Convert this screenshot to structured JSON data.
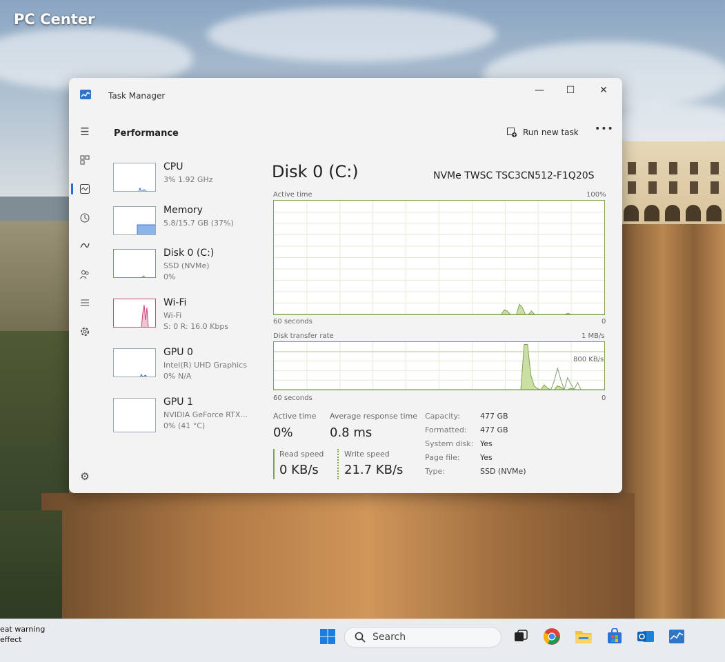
{
  "watermark": {
    "brand": "PC Center"
  },
  "notification": {
    "line1": "eat warning",
    "line2": "effect"
  },
  "window": {
    "title": "Task Manager",
    "controls": {
      "minimize": "—",
      "maximize": "☐",
      "close": "✕"
    }
  },
  "nav": {
    "icons": [
      "hamburger-icon",
      "processes-icon",
      "performance-icon",
      "app-history-icon",
      "startup-apps-icon",
      "users-icon",
      "details-icon",
      "services-icon",
      "settings-icon"
    ],
    "active": "performance-icon"
  },
  "header": {
    "page_title": "Performance",
    "run_new_task": "Run new task",
    "more": "•••"
  },
  "devices": [
    {
      "name": "CPU",
      "sub1": "3% 1.92 GHz",
      "sub2": ""
    },
    {
      "name": "Memory",
      "sub1": "5.8/15.7 GB (37%)",
      "sub2": ""
    },
    {
      "name": "Disk 0 (C:)",
      "sub1": "SSD (NVMe)",
      "sub2": "0%"
    },
    {
      "name": "Wi-Fi",
      "sub1": "Wi-Fi",
      "sub2": "S: 0 R: 16.0 Kbps"
    },
    {
      "name": "GPU 0",
      "sub1": "Intel(R) UHD Graphics",
      "sub2": "0% N/A"
    },
    {
      "name": "GPU 1",
      "sub1": "NVIDIA GeForce RTX...",
      "sub2": "0% (41 °C)"
    }
  ],
  "detail": {
    "title": "Disk 0 (C:)",
    "model": "NVMe TWSC TSC3CN512-F1Q20S",
    "active_graph": {
      "label": "Active time",
      "max_label": "100%",
      "x_label": "60 seconds",
      "min_label": "0",
      "values": [
        0,
        0,
        0,
        0,
        0,
        0,
        0,
        0,
        0,
        0,
        0,
        0,
        0,
        0,
        0,
        0,
        0,
        0,
        0,
        0,
        0,
        0,
        0,
        0,
        0,
        0,
        0,
        0,
        0,
        0,
        0,
        0,
        0,
        0,
        0,
        0,
        0,
        0,
        0,
        0,
        0,
        0,
        0,
        0,
        0,
        0,
        0,
        0,
        0,
        0,
        0,
        0,
        0,
        0,
        0,
        0,
        0,
        0,
        0,
        0,
        0,
        0,
        0,
        0,
        0,
        0,
        0,
        0,
        0,
        0,
        0,
        0,
        0,
        0,
        0,
        0,
        4,
        3,
        0,
        0,
        0,
        9,
        6,
        0,
        0,
        3,
        0,
        0,
        0,
        0,
        0,
        0,
        0,
        0,
        0,
        0,
        0,
        1,
        0,
        0,
        0,
        0,
        0,
        0,
        0,
        0,
        0,
        0,
        0,
        0
      ]
    },
    "transfer_graph": {
      "label": "Disk transfer rate",
      "max_label": "1 MB/s",
      "mid_label": "800 KB/s",
      "x_label": "60 seconds",
      "min_label": "0",
      "read_values": [
        0,
        0,
        0,
        0,
        0,
        0,
        0,
        0,
        0,
        0,
        0,
        0,
        0,
        0,
        0,
        0,
        0,
        0,
        0,
        0,
        0,
        0,
        0,
        0,
        0,
        0,
        0,
        0,
        0,
        0,
        0,
        0,
        0,
        0,
        0,
        0,
        0,
        0,
        0,
        0,
        0,
        0,
        0,
        0,
        0,
        0,
        0,
        0,
        0,
        0,
        0,
        0,
        0,
        0,
        0,
        0,
        0,
        0,
        0,
        0,
        0,
        0,
        0,
        0,
        0,
        0,
        0,
        0,
        0,
        0,
        0,
        0,
        0,
        0,
        0,
        0,
        0,
        0,
        0,
        0,
        0,
        0,
        0,
        0,
        0,
        0,
        0,
        0,
        0,
        0,
        0,
        0,
        0,
        0,
        0,
        0,
        0,
        0,
        0,
        0
      ],
      "write_values": [
        0,
        0,
        0,
        0,
        0,
        0,
        0,
        0,
        0,
        0,
        0,
        0,
        0,
        0,
        0,
        0,
        0,
        0,
        0,
        0,
        0,
        0,
        0,
        0,
        0,
        0,
        0,
        0,
        0,
        0,
        0,
        0,
        0,
        0,
        0,
        0,
        0,
        0,
        0,
        0,
        0,
        0,
        0,
        0,
        0,
        0,
        0,
        0,
        0,
        0,
        0,
        0,
        0,
        0,
        0,
        0,
        0,
        0,
        0,
        0,
        0,
        0,
        0,
        0,
        0,
        0,
        0,
        0,
        0,
        0,
        0,
        0,
        0,
        0,
        0,
        95,
        95,
        30,
        8,
        2,
        0,
        10,
        3,
        0,
        0,
        8,
        5,
        0,
        0,
        3,
        0,
        0,
        0,
        0,
        0,
        0,
        0,
        0,
        0,
        0
      ],
      "write_peaks_extra": [
        0,
        0,
        0,
        0,
        0,
        0,
        0,
        0,
        0,
        0,
        0,
        0,
        0,
        0,
        0,
        0,
        0,
        0,
        0,
        0,
        0,
        0,
        0,
        0,
        0,
        0,
        0,
        0,
        0,
        0,
        0,
        0,
        0,
        0,
        0,
        0,
        0,
        0,
        0,
        0,
        0,
        0,
        0,
        0,
        0,
        0,
        0,
        0,
        0,
        0,
        0,
        0,
        0,
        0,
        0,
        0,
        0,
        0,
        0,
        0,
        0,
        0,
        0,
        0,
        0,
        0,
        0,
        0,
        0,
        0,
        0,
        0,
        0,
        0,
        0,
        0,
        0,
        0,
        0,
        0,
        0,
        0,
        0,
        0,
        18,
        45,
        20,
        0,
        25,
        12,
        0,
        15,
        0,
        0,
        0,
        0,
        0,
        0,
        0,
        0
      ]
    },
    "stats": {
      "active_time_label": "Active time",
      "active_time_value": "0%",
      "avg_response_label": "Average response time",
      "avg_response_value": "0.8 ms",
      "read_speed_label": "Read speed",
      "read_speed_value": "0 KB/s",
      "write_speed_label": "Write speed",
      "write_speed_value": "21.7 KB/s"
    },
    "properties": [
      {
        "label": "Capacity:",
        "value": "477 GB"
      },
      {
        "label": "Formatted:",
        "value": "477 GB"
      },
      {
        "label": "System disk:",
        "value": "Yes"
      },
      {
        "label": "Page file:",
        "value": "Yes"
      },
      {
        "label": "Type:",
        "value": "SSD (NVMe)"
      }
    ]
  },
  "taskbar": {
    "search_placeholder": "Search",
    "apps": [
      "windows-start-icon",
      "task-view-icon",
      "chrome-icon",
      "file-explorer-icon",
      "microsoft-store-icon",
      "outlook-icon",
      "task-manager-icon"
    ]
  },
  "colors": {
    "accent": "#2a6ad6",
    "disk_green": "#7fa24e",
    "disk_fill": "#c9dfa3"
  }
}
